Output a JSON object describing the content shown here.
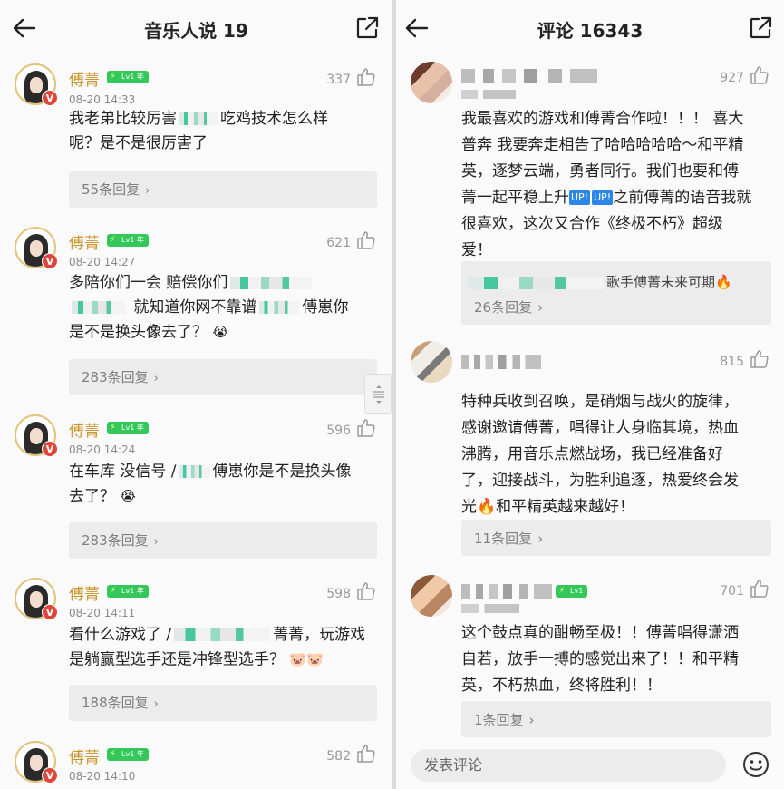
{
  "left_panel": {
    "title": "音乐人说 19",
    "comments": [
      {
        "user": "傅菁",
        "level": "Lv1 年",
        "time": "08-20 14:33",
        "likes": "337",
        "text_a": "我老弟比较厉害",
        "text_b": "吃鸡技术怎么样",
        "text_c": "呢？是不是很厉害了",
        "replies": "55条回复"
      },
      {
        "user": "傅菁",
        "level": "Lv1 年",
        "time": "08-20 14:27",
        "likes": "621",
        "text_a": "多陪你们一会 赔偿你们",
        "text_b": "就知道你网不靠谱",
        "text_c": "傅崽你",
        "text_d": "是不是换头像去了？",
        "emoji": "😭",
        "replies": "283条回复"
      },
      {
        "user": "傅菁",
        "level": "Lv1 年",
        "time": "08-20 14:24",
        "likes": "596",
        "text_a": "在车库 没信号 /",
        "text_b": "傅崽你是不是换头像",
        "text_c": "去了？",
        "emoji": "😭",
        "replies": "283条回复"
      },
      {
        "user": "傅菁",
        "level": "Lv1 年",
        "time": "08-20 14:11",
        "likes": "598",
        "text_a": "看什么游戏了 /",
        "text_b": "菁菁，玩游戏",
        "text_c": "是躺赢型选手还是冲锋型选手？",
        "emoji": "🐷🐷",
        "replies": "188条回复"
      },
      {
        "user": "傅菁",
        "level": "Lv1 年",
        "time": "08-20 14:10",
        "likes": "582"
      }
    ]
  },
  "right_panel": {
    "title": "评论 16343",
    "comments": [
      {
        "likes": "927",
        "lines": [
          "我最喜欢的游戏和傅菁合作啦！！！ 喜大",
          "普奔 我要奔走相告了哈哈哈哈哈～和平精",
          "英，逐梦云端，勇者同行。我们也要和傅"
        ],
        "line4_a": "菁一起平稳上升",
        "up1": "UP!",
        "up2": "UP!",
        "line4_b": "之前傅菁的语音我就",
        "line5": "很喜欢，这次又合作《终极不朽》超级",
        "line6": "爱！",
        "subreply_text": "歌手傅菁未来可期",
        "subreply_emoji": "🔥",
        "replies": "26条回复"
      },
      {
        "likes": "815",
        "lines": [
          "特种兵收到召唤，是硝烟与战火的旋律，",
          "感谢邀请傅菁，唱得让人身临其境，热血",
          "沸腾，用音乐点燃战场，我已经准备好",
          "了，迎接战斗，为胜利追逐，热爱终会发"
        ],
        "line5_a": "光",
        "line5_emoji": "🔥",
        "line5_b": "和平精英越来越好！",
        "replies": "11条回复"
      },
      {
        "likes": "701",
        "level": "Lv1",
        "lines": [
          "这个鼓点真的酣畅至极！！傅菁唱得潇洒",
          "自若，放手一搏的感觉出来了！！和平精",
          "英，不朽热血，终将胜利！！"
        ],
        "replies": "1条回复"
      }
    ],
    "input_placeholder": "发表评论"
  },
  "colors": {
    "username": "#c9962e",
    "level_badge": "#34c759",
    "verified": "#e0453a",
    "up_tag": "#2b86e6"
  }
}
